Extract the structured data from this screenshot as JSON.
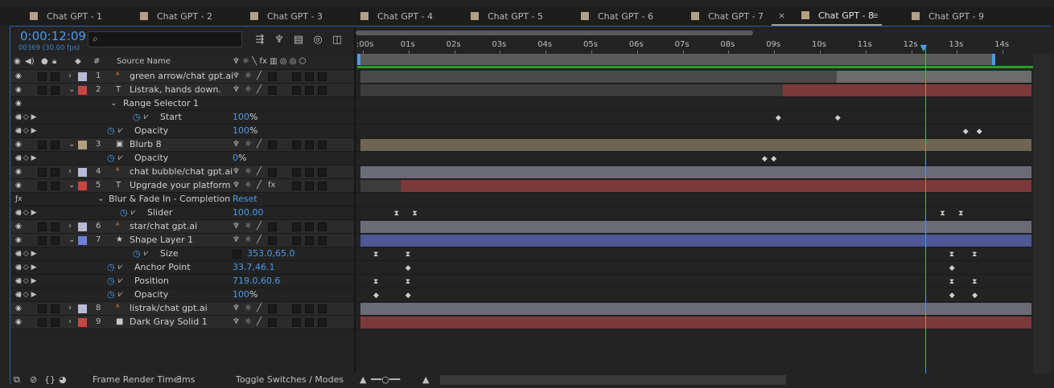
{
  "tabs": [
    {
      "label": "Chat GPT - 1"
    },
    {
      "label": "Chat GPT - 2"
    },
    {
      "label": "Chat GPT - 3"
    },
    {
      "label": "Chat GPT - 4"
    },
    {
      "label": "Chat GPT - 5"
    },
    {
      "label": "Chat GPT - 6"
    },
    {
      "label": "Chat GPT - 7"
    },
    {
      "label": "Chat GPT - 8"
    },
    {
      "label": "Chat GPT - 9"
    }
  ],
  "active_tab": "Chat GPT - 8",
  "tab_close": "×",
  "tab_menu": "≡",
  "header": {
    "timecode": "0:00:12:09",
    "frames": "00369 (30.00 fps)",
    "search_placeholder": "",
    "search_icon": "search-icon"
  },
  "columns": {
    "label_number": "#",
    "source_name": "Source Name"
  },
  "ruler_ticks": [
    ":00s",
    "01s",
    "02s",
    "03s",
    "04s",
    "05s",
    "06s",
    "07s",
    "08s",
    "09s",
    "10s",
    "11s",
    "12s",
    "13s",
    "14s"
  ],
  "rows": [
    {
      "type": "layer",
      "num": "1",
      "name": "green arrow/chat gpt.ai",
      "icon": "ai-icon",
      "label_color": "#b9b9d8",
      "twirl": "›",
      "fx": false
    },
    {
      "type": "layer",
      "num": "2",
      "name": "Listrak, hands down.",
      "icon": "text-layer-icon",
      "label_color": "#c94545",
      "twirl": "⌄",
      "fx": false
    },
    {
      "type": "group",
      "name": "Range Selector 1"
    },
    {
      "type": "prop",
      "name": "Start",
      "value": "100",
      "unit": "%"
    },
    {
      "type": "prop",
      "name": "Opacity",
      "value": "100",
      "unit": "%"
    },
    {
      "type": "layer",
      "num": "3",
      "name": "Blurb 8",
      "icon": "comp-icon",
      "label_color": "#b39e80",
      "twirl": "⌄",
      "fx": false
    },
    {
      "type": "prop",
      "name": "Opacity",
      "value": "0",
      "unit": "%"
    },
    {
      "type": "layer",
      "num": "4",
      "name": "chat bubble/chat gpt.ai",
      "icon": "ai-icon",
      "label_color": "#b9b9d8",
      "twirl": "›",
      "fx": false
    },
    {
      "type": "layer",
      "num": "5",
      "name": "Upgrade your platform",
      "icon": "text-layer-icon",
      "label_color": "#c94545",
      "twirl": "⌄",
      "fx": true
    },
    {
      "type": "effect",
      "name": "Blur & Fade In - Completion",
      "value": "Reset"
    },
    {
      "type": "prop",
      "name": "Slider",
      "value": "100.00",
      "unit": ""
    },
    {
      "type": "layer",
      "num": "6",
      "name": "star/chat gpt.ai",
      "icon": "ai-icon",
      "label_color": "#b9b9d8",
      "twirl": "›",
      "fx": false
    },
    {
      "type": "layer",
      "num": "7",
      "name": "Shape Layer 1",
      "icon": "star-icon",
      "label_color": "#6f7fd8",
      "twirl": "⌄",
      "fx": false
    },
    {
      "type": "prop",
      "name": "Size",
      "value": "353.0,65.0",
      "unit": ""
    },
    {
      "type": "prop",
      "name": "Anchor Point",
      "value": "33.7,46.1",
      "unit": ""
    },
    {
      "type": "prop",
      "name": "Position",
      "value": "719.0,60.6",
      "unit": ""
    },
    {
      "type": "prop",
      "name": "Opacity",
      "value": "100",
      "unit": "%"
    },
    {
      "type": "layer",
      "num": "8",
      "name": "listrak/chat gpt.ai",
      "icon": "ai-icon",
      "label_color": "#b9b9d8",
      "twirl": "›",
      "fx": false
    },
    {
      "type": "layer",
      "num": "9",
      "name": "Dark Gray Solid 1",
      "icon": "solid-icon",
      "label_color": "#c94545",
      "twirl": "›",
      "fx": false
    }
  ],
  "timeline_bars": [
    {
      "row": 0,
      "color": "#6c6c6c",
      "start": 0.71,
      "end": 1.0,
      "base": "#4a4a4a"
    },
    {
      "row": 1,
      "color": "#7a3a3a",
      "start": 0.63,
      "end": 1.0,
      "base": "#3c3c3c"
    },
    {
      "row": 5,
      "color": "#6e6452",
      "start": 0.0,
      "end": 1.0,
      "base": ""
    },
    {
      "row": 7,
      "color": "#6b6b78",
      "start": 0.0,
      "end": 1.0,
      "base": ""
    },
    {
      "row": 8,
      "color": "#7a3a3a",
      "start": 0.06,
      "end": 1.0,
      "base": "#3c3c3c"
    },
    {
      "row": 11,
      "color": "#6b6b78",
      "start": 0.0,
      "end": 1.0,
      "base": ""
    },
    {
      "row": 12,
      "color": "#4d5894",
      "start": 0.0,
      "end": 1.0,
      "base": ""
    },
    {
      "row": 17,
      "color": "#6b6b78",
      "start": 0.0,
      "end": 1.0,
      "base": ""
    },
    {
      "row": 18,
      "color": "#7a3a3a",
      "start": 0.0,
      "end": 1.0,
      "base": ""
    }
  ],
  "keyframes": [
    {
      "row": 3,
      "times": [
        9.1,
        10.4
      ],
      "glyph": "◆"
    },
    {
      "row": 4,
      "times": [
        13.2,
        13.5
      ],
      "glyph": "◆"
    },
    {
      "row": 6,
      "times": [
        8.8,
        9.0
      ],
      "glyph": "◆"
    },
    {
      "row": 10,
      "times": [
        0.75,
        1.15,
        12.7,
        13.1
      ],
      "glyph": "⧗"
    },
    {
      "row": 13,
      "times": [
        0.3,
        1.0,
        12.9,
        13.4
      ],
      "glyph": "⧗"
    },
    {
      "row": 14,
      "times": [
        1.0,
        12.9
      ],
      "glyph": "◆"
    },
    {
      "row": 15,
      "times": [
        0.3,
        1.0,
        12.9,
        13.4
      ],
      "glyph": "⧗"
    },
    {
      "row": 16,
      "times": [
        0.3,
        1.0,
        12.9,
        13.4
      ],
      "glyph": "◆"
    }
  ],
  "current_time_seconds": 12.3,
  "footer": {
    "frame_render_label": "Frame Render Time:",
    "frame_render_value": "3ms",
    "toggle_label": "Toggle Switches / Modes"
  }
}
